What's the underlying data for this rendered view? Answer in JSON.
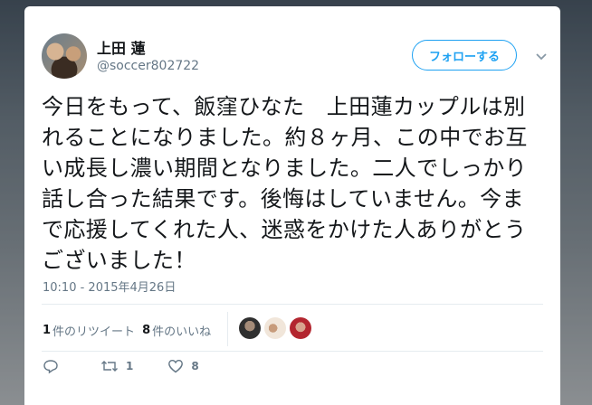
{
  "tweet": {
    "display_name": "上田 蓮",
    "handle": "@soccer802722",
    "follow_label": "フォローする",
    "text": "今日をもって、飯窪ひなた　上田蓮カップルは別れることになりました。約８ヶ月、この中でお互い成長し濃い期間となりました。二人でしっかり話し合った結果です。後悔はしていません。今まで応援してくれた人、迷惑をかけた人ありがとうございました！",
    "timestamp": "10:10 - 2015年4月26日"
  },
  "stats": {
    "retweets_count": "1",
    "retweets_label": "件のリツイート",
    "likes_count": "8",
    "likes_label": "件のいいね"
  },
  "actions": {
    "reply_icon": "reply-icon",
    "retweet_icon": "retweet-icon",
    "retweet_count": "1",
    "like_icon": "heart-icon",
    "like_count": "8"
  },
  "colors": {
    "accent": "#1da1f2",
    "text": "#14171a",
    "muted": "#657786"
  }
}
